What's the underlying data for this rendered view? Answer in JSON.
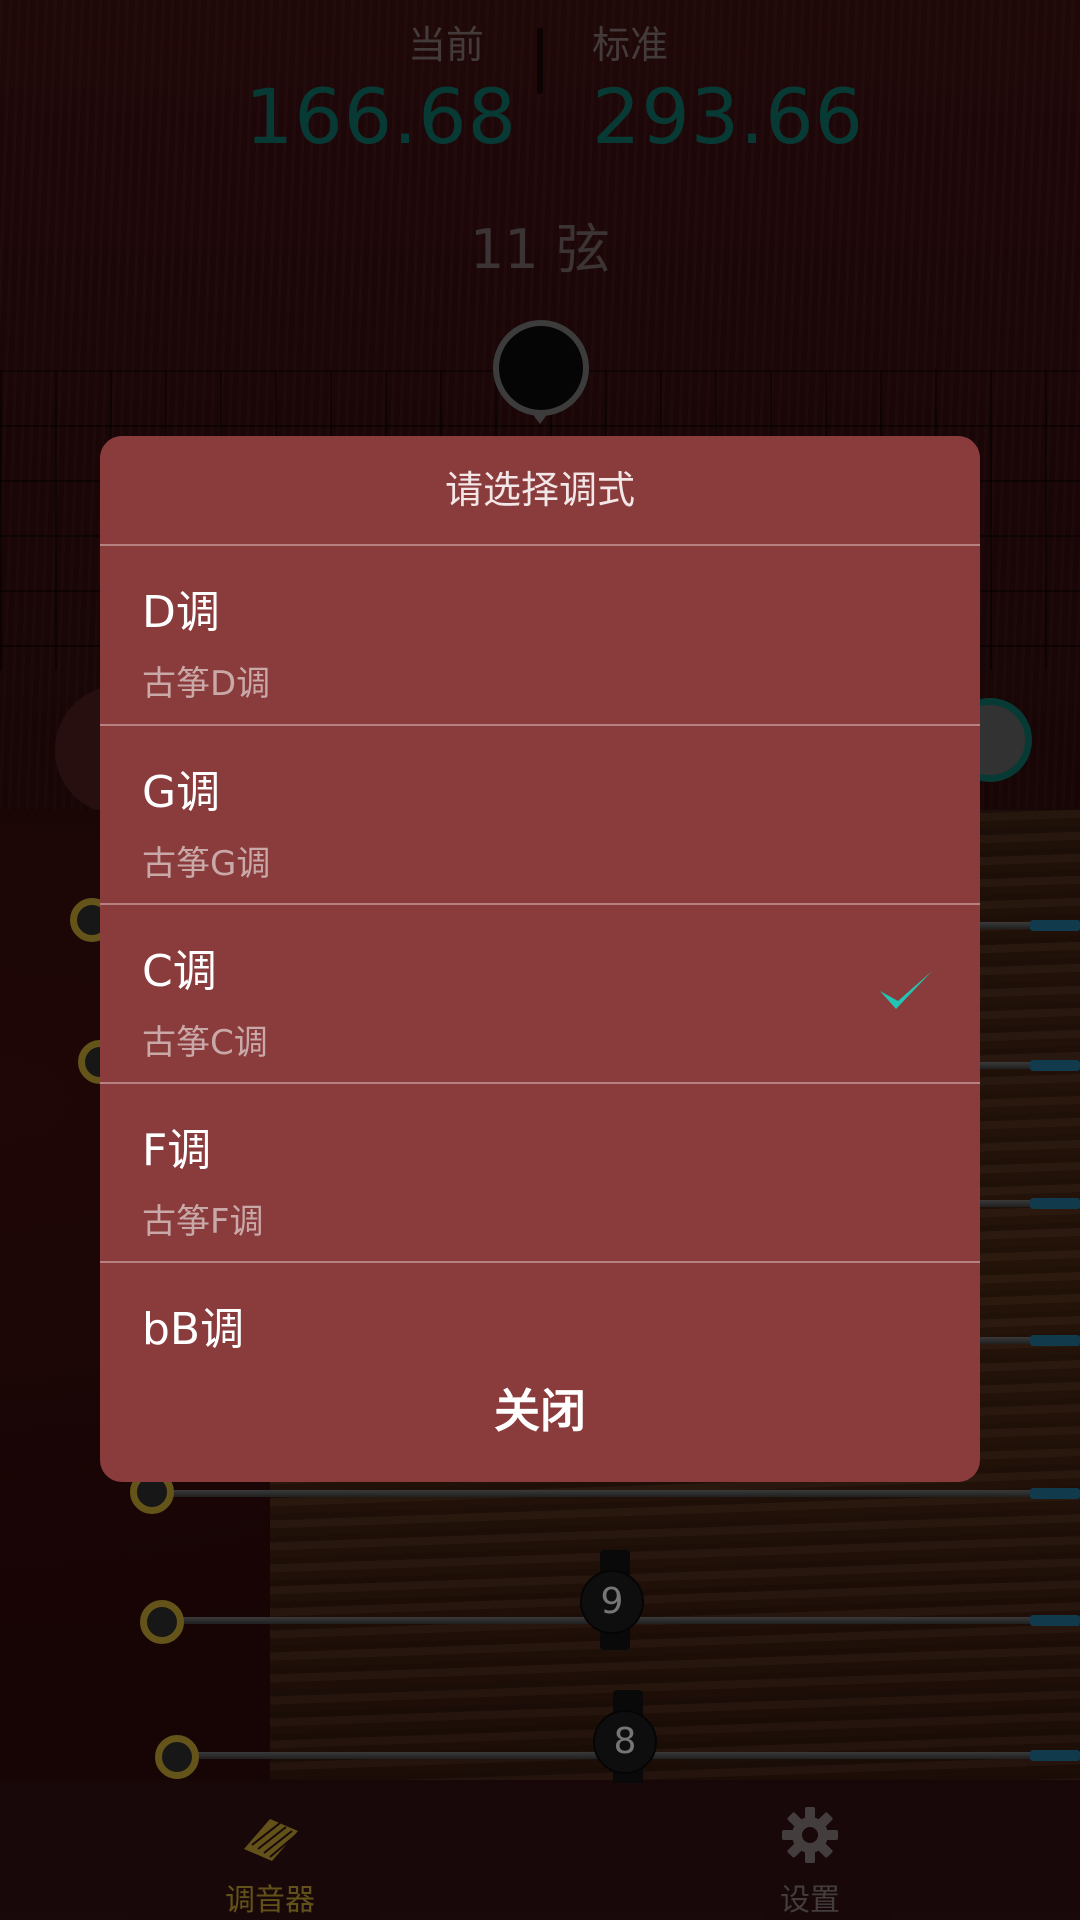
{
  "tuner": {
    "current_label": "当前",
    "standard_label": "标准",
    "current_value": "166.68",
    "standard_value": "293.66",
    "string_label": "11 弦"
  },
  "board": {
    "bridge_numbers": [
      "9",
      "8"
    ]
  },
  "dialog": {
    "title": "请选择调式",
    "options": [
      {
        "name": "D调",
        "desc": "古筝D调",
        "selected": false
      },
      {
        "name": "G调",
        "desc": "古筝G调",
        "selected": false
      },
      {
        "name": "C调",
        "desc": "古筝C调",
        "selected": true
      },
      {
        "name": "F调",
        "desc": "古筝F调",
        "selected": false
      },
      {
        "name": "bB调",
        "desc": "",
        "selected": false
      }
    ],
    "close_label": "关闭",
    "check_color": "#22c4b4"
  },
  "bottom_nav": {
    "items": [
      {
        "label": "调音器",
        "icon": "guzheng-icon",
        "active": true
      },
      {
        "label": "设置",
        "icon": "gear-icon",
        "active": false
      }
    ]
  }
}
